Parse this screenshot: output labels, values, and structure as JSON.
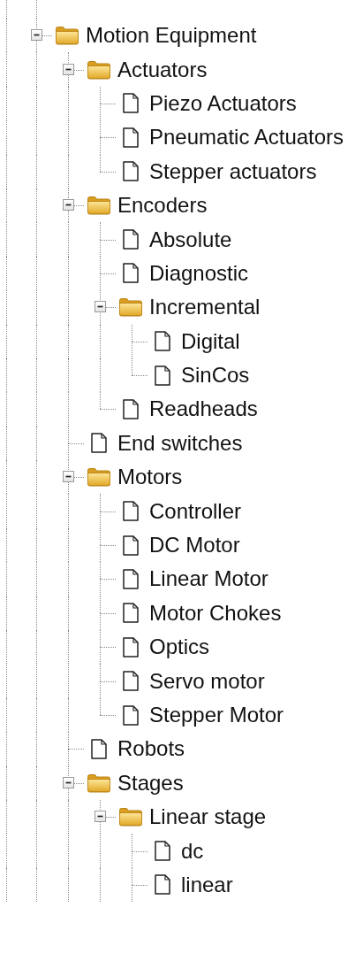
{
  "tree": [
    {
      "label": "Motion Equipment",
      "kind": "folder",
      "expanded": true,
      "children": [
        {
          "label": "Actuators",
          "kind": "folder",
          "expanded": true,
          "children": [
            {
              "label": "Piezo Actuators",
              "kind": "leaf"
            },
            {
              "label": "Pneumatic Actuators",
              "kind": "leaf"
            },
            {
              "label": "Stepper actuators",
              "kind": "leaf"
            }
          ]
        },
        {
          "label": "Encoders",
          "kind": "folder",
          "expanded": true,
          "children": [
            {
              "label": "Absolute",
              "kind": "leaf"
            },
            {
              "label": "Diagnostic",
              "kind": "leaf"
            },
            {
              "label": "Incremental",
              "kind": "folder",
              "expanded": true,
              "children": [
                {
                  "label": "Digital",
                  "kind": "leaf"
                },
                {
                  "label": "SinCos",
                  "kind": "leaf"
                }
              ]
            },
            {
              "label": "Readheads",
              "kind": "leaf"
            }
          ]
        },
        {
          "label": "End switches",
          "kind": "leaf"
        },
        {
          "label": "Motors",
          "kind": "folder",
          "expanded": true,
          "children": [
            {
              "label": "Controller",
              "kind": "leaf"
            },
            {
              "label": "DC Motor",
              "kind": "leaf"
            },
            {
              "label": "Linear Motor",
              "kind": "leaf"
            },
            {
              "label": "Motor Chokes",
              "kind": "leaf"
            },
            {
              "label": "Optics",
              "kind": "leaf"
            },
            {
              "label": "Servo motor",
              "kind": "leaf"
            },
            {
              "label": "Stepper Motor",
              "kind": "leaf"
            }
          ]
        },
        {
          "label": "Robots",
          "kind": "leaf"
        },
        {
          "label": "Stages",
          "kind": "folder",
          "expanded": true,
          "children": [
            {
              "label": "Linear stage",
              "kind": "folder",
              "expanded": true,
              "children": [
                {
                  "label": "dc",
                  "kind": "leaf"
                },
                {
                  "label": "linear",
                  "kind": "leaf"
                }
              ]
            }
          ]
        }
      ]
    }
  ]
}
